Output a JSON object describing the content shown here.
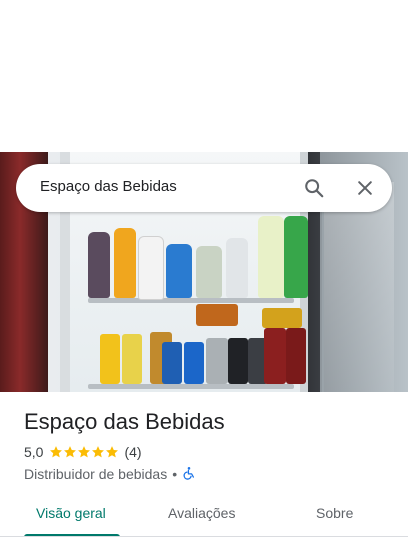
{
  "search": {
    "query": "Espaço das Bebidas"
  },
  "place": {
    "title": "Espaço das Bebidas",
    "rating": "5,0",
    "stars": 5,
    "review_count": "(4)",
    "category": "Distribuidor de bebidas",
    "separator": "•"
  },
  "tabs": [
    {
      "label": "Visão geral",
      "active": true
    },
    {
      "label": "Avaliações",
      "active": false
    },
    {
      "label": "Sobre",
      "active": false
    }
  ],
  "colors": {
    "accent": "#00796b",
    "star": "#fbbc04",
    "accessible_icon": "#1a73e8"
  },
  "icons": [
    "search-icon",
    "close-icon",
    "star-icon",
    "wheelchair-icon"
  ]
}
